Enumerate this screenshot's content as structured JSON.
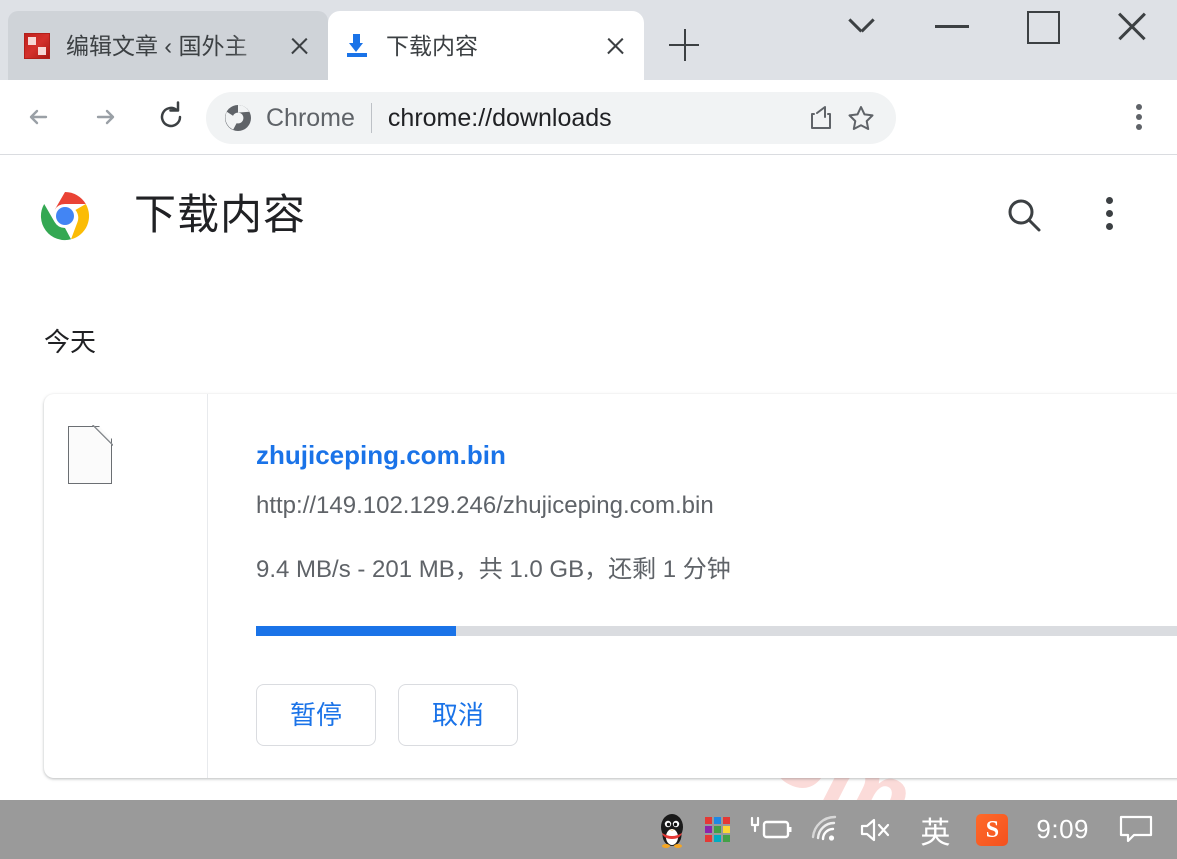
{
  "window": {
    "controls": [
      {
        "name": "tab-search",
        "glyph": "chevron-down"
      },
      {
        "name": "minimize",
        "glyph": "minus"
      },
      {
        "name": "maximize",
        "glyph": "square"
      },
      {
        "name": "close",
        "glyph": "x"
      }
    ]
  },
  "tabs": [
    {
      "title": "编辑文章 ‹ 国外主",
      "active": false,
      "icon": "wordpress-site-favicon",
      "close_label": "×"
    },
    {
      "title": "下载内容",
      "active": true,
      "icon": "download-arrow-icon",
      "close_label": "×"
    }
  ],
  "newtab": {
    "label": "+",
    "name": "new-tab-button"
  },
  "toolbar": {
    "back": "←",
    "forward": "→",
    "reload": "⟳",
    "omnibox": {
      "chip_label": "Chrome",
      "url": "chrome://downloads",
      "share_icon": "share-icon",
      "bookmark_icon": "star-icon"
    },
    "menu_icon": "three-dot-menu-icon"
  },
  "page": {
    "logo": "chrome-logo",
    "title": "下载内容",
    "search_icon": "search-icon",
    "menu_icon": "three-dot-menu-icon",
    "watermark": "zhujiceping.com",
    "section_label": "今天",
    "download": {
      "file_icon": "generic-file-icon",
      "filename": "zhujiceping.com.bin",
      "url": "http://149.102.129.246/zhujiceping.com.bin",
      "status": "9.4 MB/s - 201 MB，共 1.0 GB，还剩 1 分钟",
      "progress_percent": 20,
      "speed": "9.4 MB/s",
      "downloaded": "201 MB",
      "total_size": "1.0 GB",
      "time_remaining": "还剩 1 分钟",
      "actions": [
        {
          "label": "暂停",
          "name": "pause-button"
        },
        {
          "label": "取消",
          "name": "cancel-button"
        }
      ]
    }
  },
  "taskbar": {
    "items": [
      {
        "name": "qq-icon"
      },
      {
        "name": "color-tiles-icon"
      },
      {
        "name": "battery-charging-icon"
      },
      {
        "name": "wifi-icon"
      },
      {
        "name": "volume-muted-icon"
      },
      {
        "name": "ime-indicator",
        "label": "英"
      },
      {
        "name": "sogou-pinyin-icon",
        "label": "S"
      }
    ],
    "clock": "9:09",
    "notification_icon": "notification-icon"
  },
  "colors": {
    "accent_blue": "#1a73e8",
    "tabstrip_bg": "#dee1e6",
    "inactive_tab": "#cfd3d8",
    "taskbar_bg": "#9a9a9a",
    "watermark_pink": "#fbdbd9",
    "text_primary": "#202124",
    "text_secondary": "#5f6368"
  }
}
